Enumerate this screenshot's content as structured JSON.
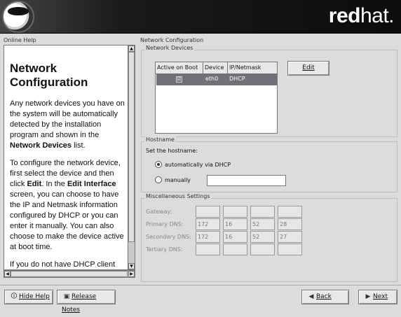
{
  "brand": {
    "logo_name": "Red Hat Shadowman",
    "text_bold": "red",
    "text_normal": "hat."
  },
  "help": {
    "section_label": "Online Help",
    "heading": "Network Configuration",
    "paragraphs": [
      "Any network devices you have on the system will be automatically detected by the installation program and shown in the Network Devices list.",
      "To configure the network device, first select the device and then click Edit. In the Edit Interface screen, you can choose to have the IP and Netmask information configured by DHCP or you can enter it manually. You can also choose to make the device active at boot time.",
      "If you do not have DHCP client access or are unsure as to what this information is, please"
    ]
  },
  "main": {
    "section_label": "Network Configuration",
    "network_devices": {
      "group_label": "Network Devices",
      "columns": [
        "Active on Boot",
        "Device",
        "IP/Netmask"
      ],
      "rows": [
        {
          "active": "☑",
          "device": "eth0",
          "ip": "DHCP"
        }
      ],
      "edit_label": "Edit"
    },
    "hostname": {
      "group_label": "Hostname",
      "prompt": "Set the hostname:",
      "auto_label": "automatically via DHCP",
      "manual_label": "manually",
      "selected": "automatically"
    },
    "misc": {
      "group_label": "Miscellaneous Settings",
      "rows": [
        {
          "label": "Gateway:",
          "values": [
            "",
            "",
            "",
            ""
          ]
        },
        {
          "label": "Primary DNS:",
          "values": [
            "172",
            "16",
            "52",
            "28"
          ]
        },
        {
          "label": "Secondary DNS:",
          "values": [
            "172",
            "16",
            "52",
            "27"
          ]
        },
        {
          "label": "Tertiary DNS:",
          "values": [
            "",
            "",
            "",
            ""
          ]
        }
      ]
    }
  },
  "bottom_bar": {
    "hide_help_label": "Hide Help",
    "release_notes_label": "Release Notes",
    "back_label": "Back",
    "next_label": "Next"
  },
  "colors": {
    "banner_dark": "#111111",
    "selection": "#6f7078",
    "window_bg": "#dcdcdc"
  },
  "icons": {
    "hide_help": "help-icon",
    "release_notes": "notes-icon",
    "back": "arrow-left-icon",
    "next": "arrow-right-icon"
  }
}
